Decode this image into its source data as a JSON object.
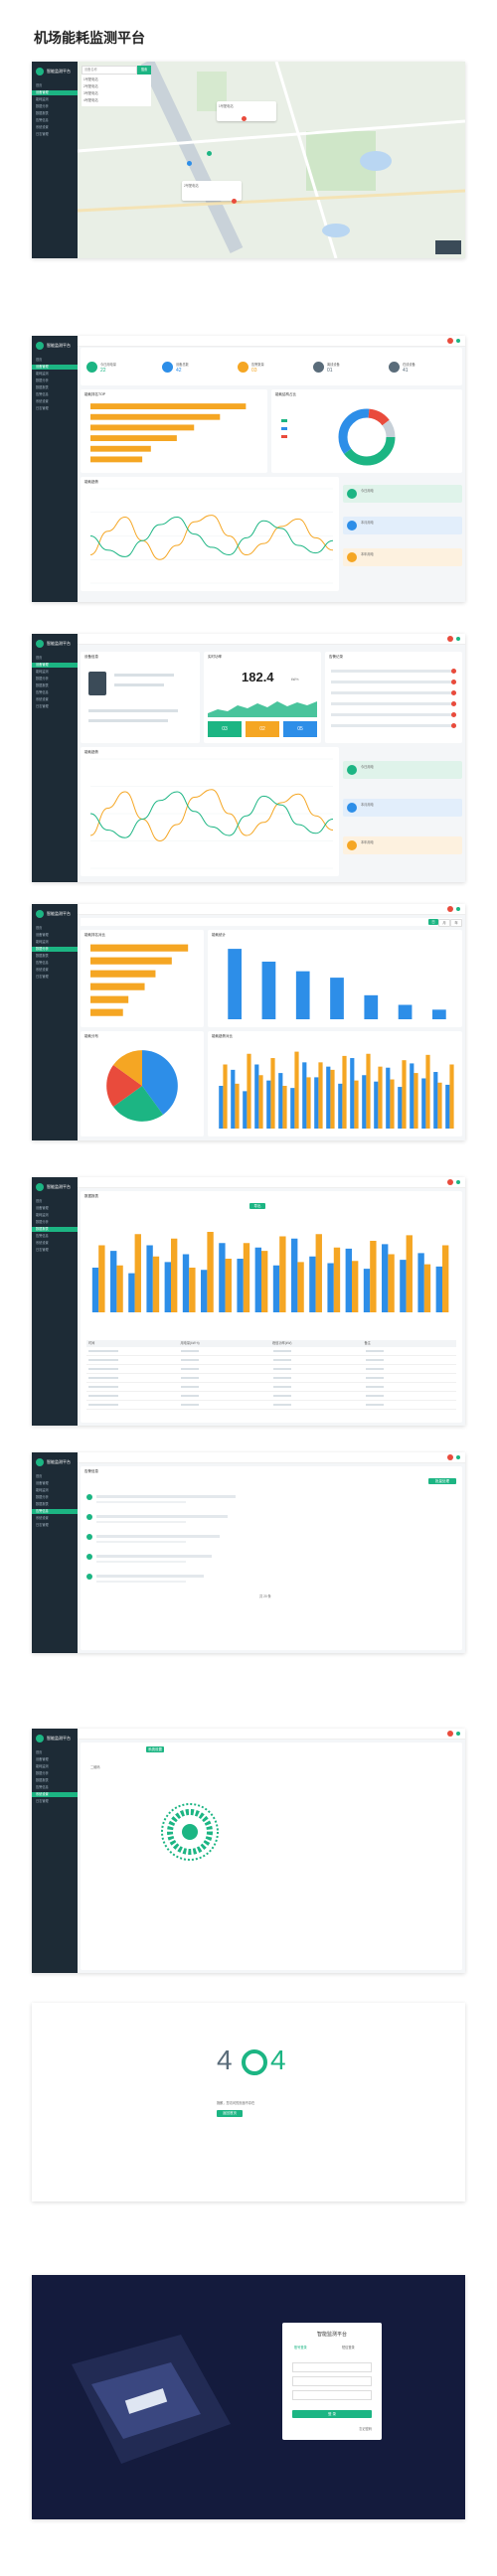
{
  "page_title": "机场能耗监测平台",
  "brand": {
    "name": "智能监测平台",
    "accent": "#1cb583",
    "dark": "#1d2b36"
  },
  "sidebar_items": [
    "首页",
    "设备管理",
    "能耗监测",
    "数据分析",
    "数据报表",
    "告警信息",
    "系统设置",
    "日志管理"
  ],
  "map_screen": {
    "search_placeholder": "设备名称",
    "search_button": "搜索",
    "list_items": [
      "1号配电站",
      "2号配电站",
      "3号配电站",
      "4号配电站"
    ],
    "popup1_title": "1号配电站",
    "popup2_title": "2号配电站"
  },
  "dashboard": {
    "stats": [
      {
        "label": "今日用电量",
        "value": "22",
        "color": "#1cb583"
      },
      {
        "label": "设备总数",
        "value": "42",
        "color": "#2d8ee8"
      },
      {
        "label": "告警数量",
        "value": "03",
        "color": "#f5a623"
      },
      {
        "label": "离线设备",
        "value": "01",
        "color": "#5a6c7a"
      },
      {
        "label": "在线设备",
        "value": "41",
        "color": "#5a6c7a"
      }
    ],
    "bar_title": "能耗排名TOP",
    "donut_title": "能耗结构占比",
    "line_title": "能耗趋势",
    "side_tags": [
      "今日用电",
      "本月用电",
      "本年用电"
    ]
  },
  "device": {
    "info_title": "设备信息",
    "gauge_title": "实时功率",
    "gauge_value": "182.4",
    "gauge_unit": "kW·h",
    "boxes": [
      "03",
      "02",
      "05"
    ],
    "alarm_title": "告警记录",
    "line_title": "能耗趋势"
  },
  "analysis": {
    "tabs": [
      "日",
      "月",
      "年"
    ],
    "left_title": "能耗排名对比",
    "right_title": "能耗统计",
    "pie_title": "能耗分布",
    "stack_title": "能耗趋势对比"
  },
  "report": {
    "title": "数据报表",
    "button": "导出",
    "columns": [
      "时间",
      "用电量(kW·h)",
      "峰值功率(kW)",
      "备注"
    ]
  },
  "alarms": {
    "title": "告警信息",
    "button": "批量处理",
    "pager": "共 20 条"
  },
  "settings": {
    "tab": "系统设置",
    "label": "二维码"
  },
  "notfound": {
    "code_left": "4",
    "code_right": "4",
    "message": "抱歉，您访问的页面不存在",
    "button": "返回首页"
  },
  "login": {
    "title": "智能监测平台",
    "tab1": "账号登录",
    "tab2": "短信登录",
    "button": "登 录",
    "link": "忘记密码"
  },
  "chart_data": [
    {
      "type": "bar",
      "title": "能耗排名TOP",
      "orientation": "horizontal",
      "values": [
        18,
        15,
        12,
        10,
        7,
        6
      ],
      "color": "#f5a623"
    },
    {
      "type": "line",
      "title": "能耗趋势",
      "series": [
        {
          "color": "#f5a623",
          "values": [
            30,
            55,
            70,
            45,
            25,
            40,
            65,
            72,
            50,
            30,
            42,
            60,
            68,
            48,
            35
          ]
        },
        {
          "color": "#1cb583",
          "values": [
            50,
            35,
            28,
            45,
            62,
            70,
            52,
            38,
            30,
            48,
            66,
            58,
            40,
            32,
            45
          ]
        }
      ]
    },
    {
      "type": "pie",
      "title": "能耗分布",
      "values": [
        40,
        25,
        20,
        15
      ],
      "colors": [
        "#2d8ee8",
        "#1cb583",
        "#e94b3c",
        "#f5a623"
      ]
    },
    {
      "type": "bar",
      "title": "能耗统计",
      "values": [
        88,
        72,
        60,
        52,
        30,
        18,
        12
      ],
      "color": "#2d8ee8"
    },
    {
      "type": "bar",
      "title": "能耗趋势对比",
      "series": [
        {
          "color": "#2d8ee8",
          "values": [
            40,
            55,
            35,
            60,
            45,
            52,
            38,
            62,
            48,
            58,
            42,
            66,
            50,
            44,
            57,
            39,
            61,
            47,
            53,
            41
          ]
        },
        {
          "color": "#f5a623",
          "values": [
            60,
            42,
            70,
            50,
            66,
            40,
            72,
            48,
            62,
            55,
            68,
            45,
            70,
            58,
            46,
            64,
            52,
            69,
            43,
            60
          ]
        }
      ]
    }
  ]
}
